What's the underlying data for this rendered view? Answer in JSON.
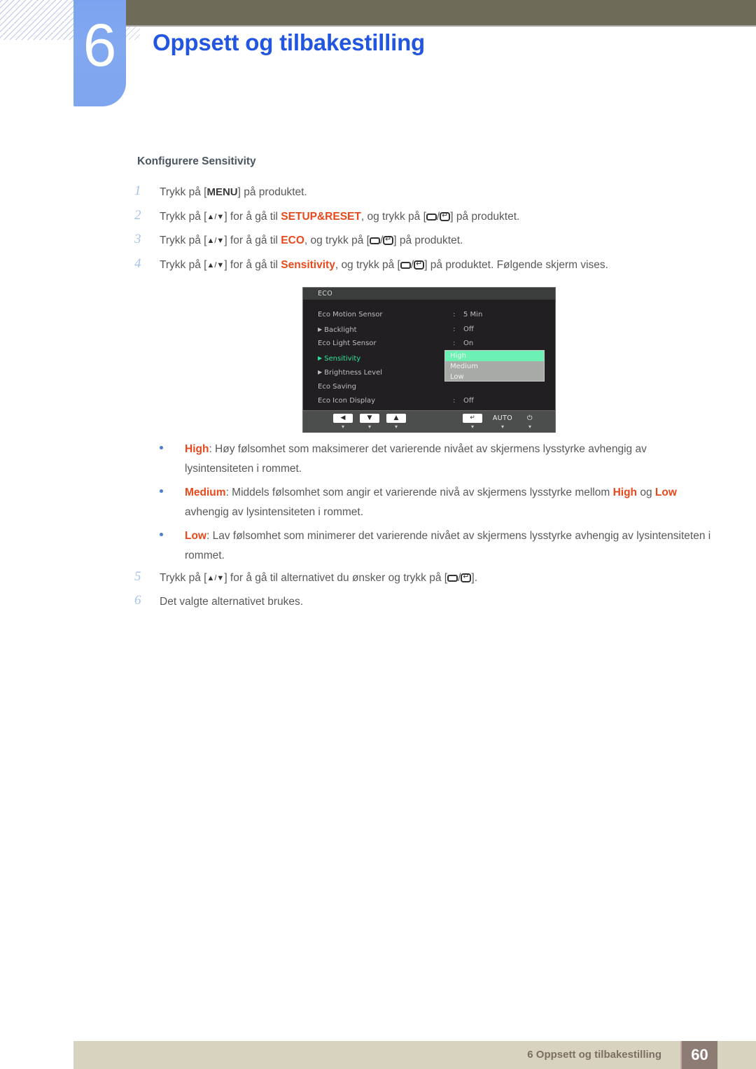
{
  "header": {
    "chapter_number": "6",
    "chapter_title": "Oppsett og tilbakestilling",
    "accent_color": "#2255e0",
    "badge_color": "#7ba3ef",
    "bar_color": "#6e6c59"
  },
  "section": {
    "heading": "Konfigurere Sensitivity"
  },
  "steps": [
    {
      "number": "1",
      "parts": [
        {
          "t": "text",
          "v": "Trykk på ["
        },
        {
          "t": "menukey",
          "v": "MENU"
        },
        {
          "t": "text",
          "v": "] på produktet."
        }
      ]
    },
    {
      "number": "2",
      "parts": [
        {
          "t": "text",
          "v": "Trykk på ["
        },
        {
          "t": "updown",
          "v": "▲/▼"
        },
        {
          "t": "text",
          "v": "] for å gå til "
        },
        {
          "t": "kw",
          "v": "SETUP&RESET"
        },
        {
          "t": "text",
          "v": ", og trykk på ["
        },
        {
          "t": "rect",
          "v": ""
        },
        {
          "t": "text",
          "v": "/"
        },
        {
          "t": "enter",
          "v": ""
        },
        {
          "t": "text",
          "v": "] på produktet."
        }
      ]
    },
    {
      "number": "3",
      "parts": [
        {
          "t": "text",
          "v": "Trykk på ["
        },
        {
          "t": "updown",
          "v": "▲/▼"
        },
        {
          "t": "text",
          "v": "] for å gå til "
        },
        {
          "t": "kw",
          "v": "ECO"
        },
        {
          "t": "text",
          "v": ", og trykk på ["
        },
        {
          "t": "rect",
          "v": ""
        },
        {
          "t": "text",
          "v": "/"
        },
        {
          "t": "enter",
          "v": ""
        },
        {
          "t": "text",
          "v": "] på produktet."
        }
      ]
    },
    {
      "number": "4",
      "parts": [
        {
          "t": "text",
          "v": "Trykk på ["
        },
        {
          "t": "updown",
          "v": "▲/▼"
        },
        {
          "t": "text",
          "v": "] for å gå til "
        },
        {
          "t": "kw",
          "v": "Sensitivity"
        },
        {
          "t": "text",
          "v": ", og trykk på ["
        },
        {
          "t": "rect",
          "v": ""
        },
        {
          "t": "text",
          "v": "/"
        },
        {
          "t": "enter",
          "v": ""
        },
        {
          "t": "text",
          "v": "] på produktet. Følgende skjerm vises."
        }
      ]
    },
    {
      "number": "5",
      "parts": [
        {
          "t": "text",
          "v": "Trykk på ["
        },
        {
          "t": "updown",
          "v": "▲/▼"
        },
        {
          "t": "text",
          "v": "] for å gå til alternativet du ønsker og trykk på ["
        },
        {
          "t": "rect",
          "v": ""
        },
        {
          "t": "text",
          "v": "/"
        },
        {
          "t": "enter",
          "v": ""
        },
        {
          "t": "text",
          "v": "]."
        }
      ]
    },
    {
      "number": "6",
      "parts": [
        {
          "t": "text",
          "v": "Det valgte alternativet brukes."
        }
      ]
    }
  ],
  "osd": {
    "title": "ECO",
    "rows": [
      {
        "label": "Eco Motion Sensor",
        "arrow": false,
        "colon": ":",
        "value": "5 Min",
        "selected": false
      },
      {
        "label": "Backlight",
        "arrow": true,
        "colon": ":",
        "value": "Off",
        "selected": false
      },
      {
        "label": "Eco Light Sensor",
        "arrow": false,
        "colon": ":",
        "value": "On",
        "selected": false
      },
      {
        "label": "Sensitivity",
        "arrow": true,
        "colon": ":",
        "value": "",
        "selected": true
      },
      {
        "label": "Brightness Level",
        "arrow": true,
        "colon": ":",
        "value": "",
        "selected": false
      },
      {
        "label": "Eco Saving",
        "arrow": false,
        "colon": "",
        "value": "",
        "selected": false
      },
      {
        "label": "Eco Icon Display",
        "arrow": false,
        "colon": ":",
        "value": "Off",
        "selected": false
      }
    ],
    "dropdown": {
      "options": [
        "High",
        "Medium",
        "Low"
      ],
      "highlighted": "High",
      "highlight_color": "#6df0b4",
      "background_color": "#a8aaa8"
    },
    "buttons": [
      {
        "icon": "left-arrow-key",
        "glyph": "◀",
        "sub": "▾",
        "boxed": true
      },
      {
        "icon": "down-arrow-key",
        "glyph": "▼",
        "sub": "▾",
        "boxed": true
      },
      {
        "icon": "up-arrow-key",
        "glyph": "▲",
        "sub": "▾",
        "boxed": true
      },
      {
        "icon": "enter-key",
        "glyph": "↵",
        "sub": "▾",
        "boxed": true
      },
      {
        "icon": "auto-key",
        "glyph": "AUTO",
        "sub": "▾",
        "boxed": false
      },
      {
        "icon": "power-key",
        "glyph": "⏻",
        "sub": "▾",
        "boxed": false
      }
    ]
  },
  "bullets": [
    {
      "parts": [
        {
          "t": "kw",
          "v": "High"
        },
        {
          "t": "text",
          "v": ": Høy følsomhet som maksimerer det varierende nivået av skjermens lysstyrke avhengig av lysintensiteten i rommet."
        }
      ]
    },
    {
      "parts": [
        {
          "t": "kw",
          "v": "Medium"
        },
        {
          "t": "text",
          "v": ": Middels følsomhet som angir et varierende nivå av skjermens lysstyrke mellom "
        },
        {
          "t": "kw",
          "v": "High"
        },
        {
          "t": "text",
          "v": " og "
        },
        {
          "t": "kw",
          "v": "Low"
        },
        {
          "t": "text",
          "v": " avhengig av lysintensiteten i rommet."
        }
      ]
    },
    {
      "parts": [
        {
          "t": "kw",
          "v": "Low"
        },
        {
          "t": "text",
          "v": ": Lav følsomhet som minimerer det varierende nivået av skjermens lysstyrke avhengig av lysintensiteten i rommet."
        }
      ]
    }
  ],
  "footer": {
    "text": "6 Oppsett og tilbakestilling",
    "page_number": "60",
    "bar_color": "#d8d3bf",
    "page_box_color": "#8d7c74"
  }
}
